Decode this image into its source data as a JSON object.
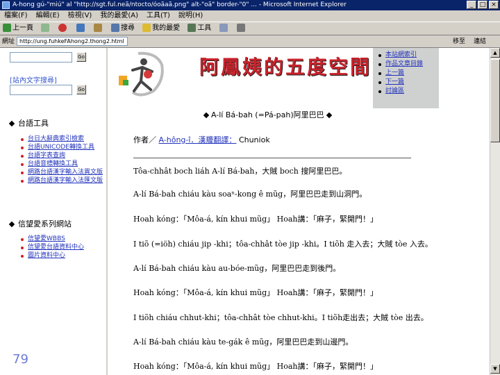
{
  "window": {
    "title": "A-hong gú-\"miú\" al \"http://sgt.ful.neã/ntocto/óoãaã.png\" alt-\"oã\" border-\"0\" ... - Microsoft Internet Explorer"
  },
  "menubar": [
    "檔案(F)",
    "編輯(E)",
    "檢視(V)",
    "我的最愛(A)",
    "工具(T)",
    "說明(H)"
  ],
  "toolbar": {
    "back": "上一頁",
    "search": "搜尋",
    "favorites": "我的最愛",
    "tools": "工具"
  },
  "addressbar": {
    "label": "網址",
    "url": "http://ung.fuhkeFAhong2.thong2.html",
    "go": "移至",
    "links": "連結"
  },
  "leftframe": {
    "search_button": "Go",
    "site_search_label": "[站內文字搜尋]",
    "tools_title": "台語工具",
    "tools_items": [
      "台日大辭典索引檢索",
      "台語UNICODE轉換工具",
      "台語字表查詢",
      "台語音標轉換工具",
      "網路台語漢字輸入法異文版",
      "網路台語漢字輸入法匯文版"
    ],
    "links_title": "信望愛系列網站",
    "links_items": [
      "信望愛WBBS",
      "信望愛台語資料中心",
      "圖片資料中心"
    ],
    "slide_number": "79"
  },
  "header": {
    "site_title": "阿鳳姨的五度空間",
    "nav": [
      "本站網索引",
      "作品文章目錄",
      "上一篇",
      "下一篇",
      "討論區"
    ]
  },
  "article": {
    "title": "A-lí Bá-bah (=Pá-pah)阿里巴巴",
    "author_label": "作者／",
    "author_name": "A-hông-î．漢羻翻譯：",
    "author_rest": "Chuniok",
    "paragraphs": [
      "Tôa-chhât boch liáh A-lí Bá-bah，大賊 boch 搜阿里巴巴。",
      "A-lí Bá-bah chiáu kàu soaⁿ-kong ê mũg，阿里巴巴走到山洞門。",
      "Hoah kóng：「Môa-á, kín khui mũg」 Hoah講：「麻子，緊開門！」",
      "I tiõ (=iöh) chiáu jip -khi；tôa-chhât tòe jip -khi。I tiõh 走入去；大賊 tòe 入去。",
      "A-lí Bá-bah chiáu kàu au-bóe-mũg，阿里巴巴走到後門。",
      "Hoah kóng：「Môa-á, kín khui mũg」 Hoah講：「麻子，緊開門！」",
      "I tiõh chiáu chhut-khi；tôa-chhât tòe chhut-khi。I tiõh走出去；大賊 tòe 出去。",
      "A-lí Bá-bah chiáu kàu te-gák ê mũg，阿里巴巴走到山邊門。",
      "Hoah kóng：「Môa-á, kín khui mũg」 Hoah講：「麻子，緊開門！」"
    ]
  },
  "colors": {
    "title_bar": "#0a246a",
    "chrome": "#d4d0c8",
    "site_title": "#c8232c",
    "link": "#2233bb"
  }
}
